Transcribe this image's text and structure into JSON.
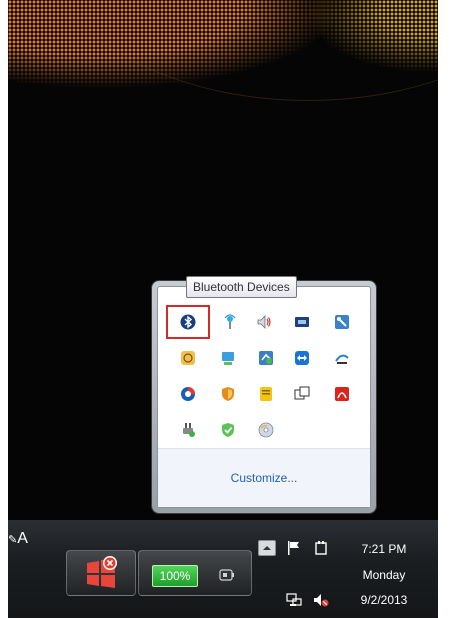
{
  "tooltip": {
    "text": "Bluetooth Devices"
  },
  "flyout": {
    "customize_label": "Customize...",
    "icons": [
      {
        "name": "bluetooth-icon",
        "selected": true
      },
      {
        "name": "wireless-icon"
      },
      {
        "name": "volume-icon"
      },
      {
        "name": "media-card-icon"
      },
      {
        "name": "settings-tool-icon"
      },
      {
        "name": "schedule-icon"
      },
      {
        "name": "network-drive-icon"
      },
      {
        "name": "sync-icon"
      },
      {
        "name": "teamviewer-icon"
      },
      {
        "name": "satellite-dish-icon"
      },
      {
        "name": "app-circle-icon"
      },
      {
        "name": "security-shield-icon"
      },
      {
        "name": "notes-icon"
      },
      {
        "name": "windows-stack-icon"
      },
      {
        "name": "pdf-icon"
      },
      {
        "name": "power-plug-icon"
      },
      {
        "name": "antivirus-check-icon"
      },
      {
        "name": "disc-icon"
      }
    ]
  },
  "taskbar": {
    "language": "A",
    "battery": "100%",
    "clock": {
      "time": "7:21 PM",
      "day": "Monday",
      "date": "9/2/2013"
    }
  }
}
